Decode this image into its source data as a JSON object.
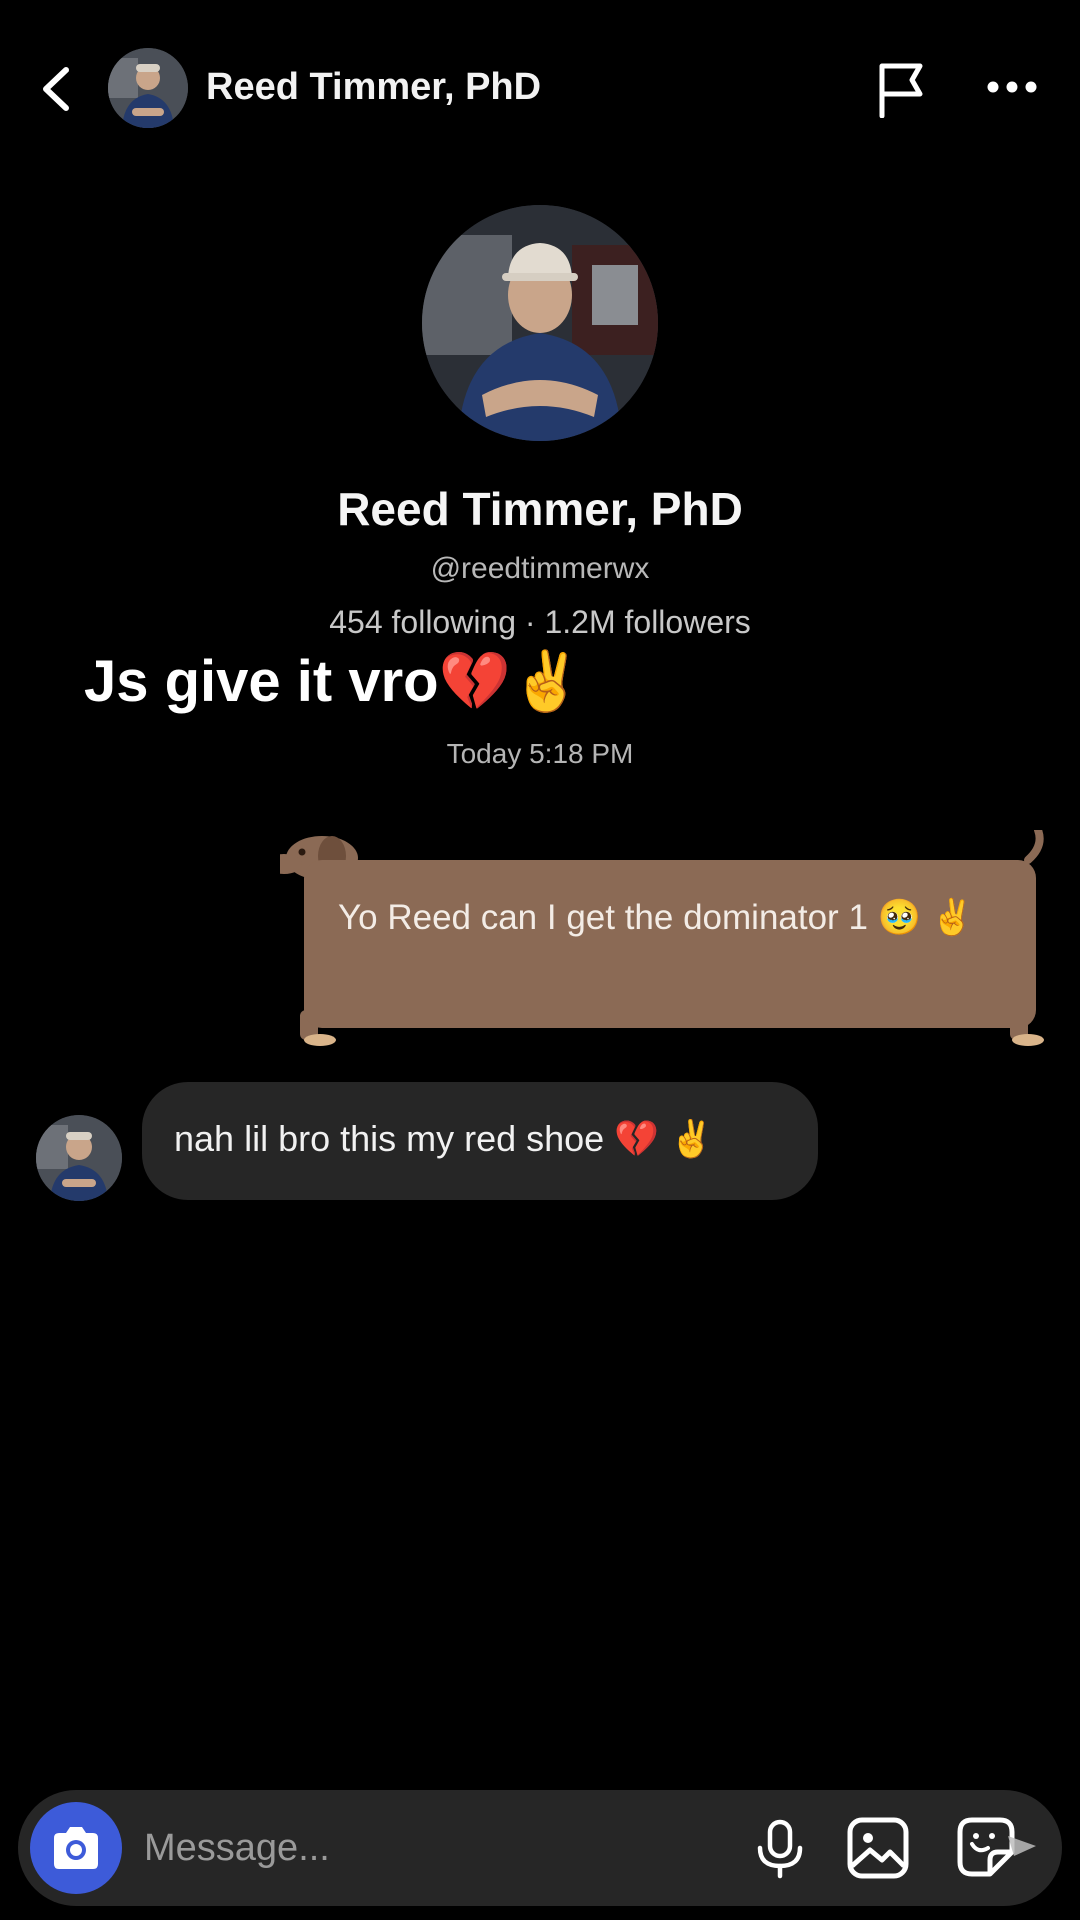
{
  "header": {
    "name": "Reed Timmer, PhD",
    "icons": [
      "chevron-left-icon",
      "flag-icon",
      "more-icon"
    ]
  },
  "profile": {
    "name": "Reed Timmer, PhD",
    "handle": "@reedtimmerwx",
    "stats": "454 following · 1.2M followers"
  },
  "caption": "Js give it vro💔✌️",
  "thread": {
    "timestamp": "Today 5:18 PM",
    "messages": [
      {
        "sender": "me",
        "text": "Yo Reed can I get the dominator 1 🥹 ✌️"
      },
      {
        "sender": "them",
        "text": "nah lil bro this my red shoe 💔 ✌️"
      }
    ]
  },
  "composer": {
    "placeholder": "Message...",
    "icons": [
      "camera-icon",
      "microphone-icon",
      "image-icon",
      "sticker-icon"
    ]
  },
  "colors": {
    "background": "#000000",
    "sent_bubble": "#8b6a55",
    "received_bubble": "#262626",
    "camera_button": "#3d5bd9"
  }
}
